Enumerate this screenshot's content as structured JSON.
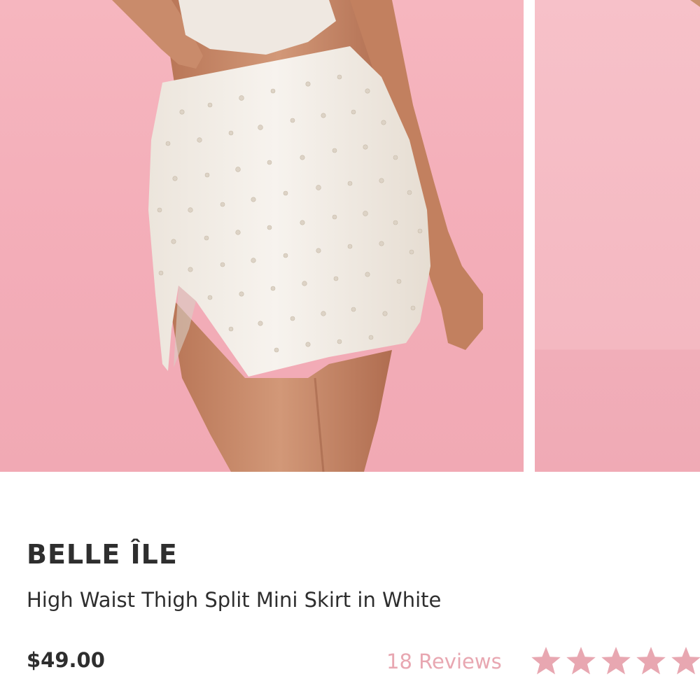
{
  "product": {
    "brand": "BELLE ÎLE",
    "title": "High Waist Thigh Split Mini Skirt in White",
    "price": "$49.00",
    "reviews_label": "18 Reviews",
    "rating": 5,
    "rating_max": 5
  },
  "gallery": {
    "main_image_icon": "product-photo-skirt",
    "next_image_icon": "product-photo-next"
  },
  "colors": {
    "background_pink": "#f4b2bc",
    "star_color": "#e8a7b1",
    "text": "#2e2e2e"
  }
}
